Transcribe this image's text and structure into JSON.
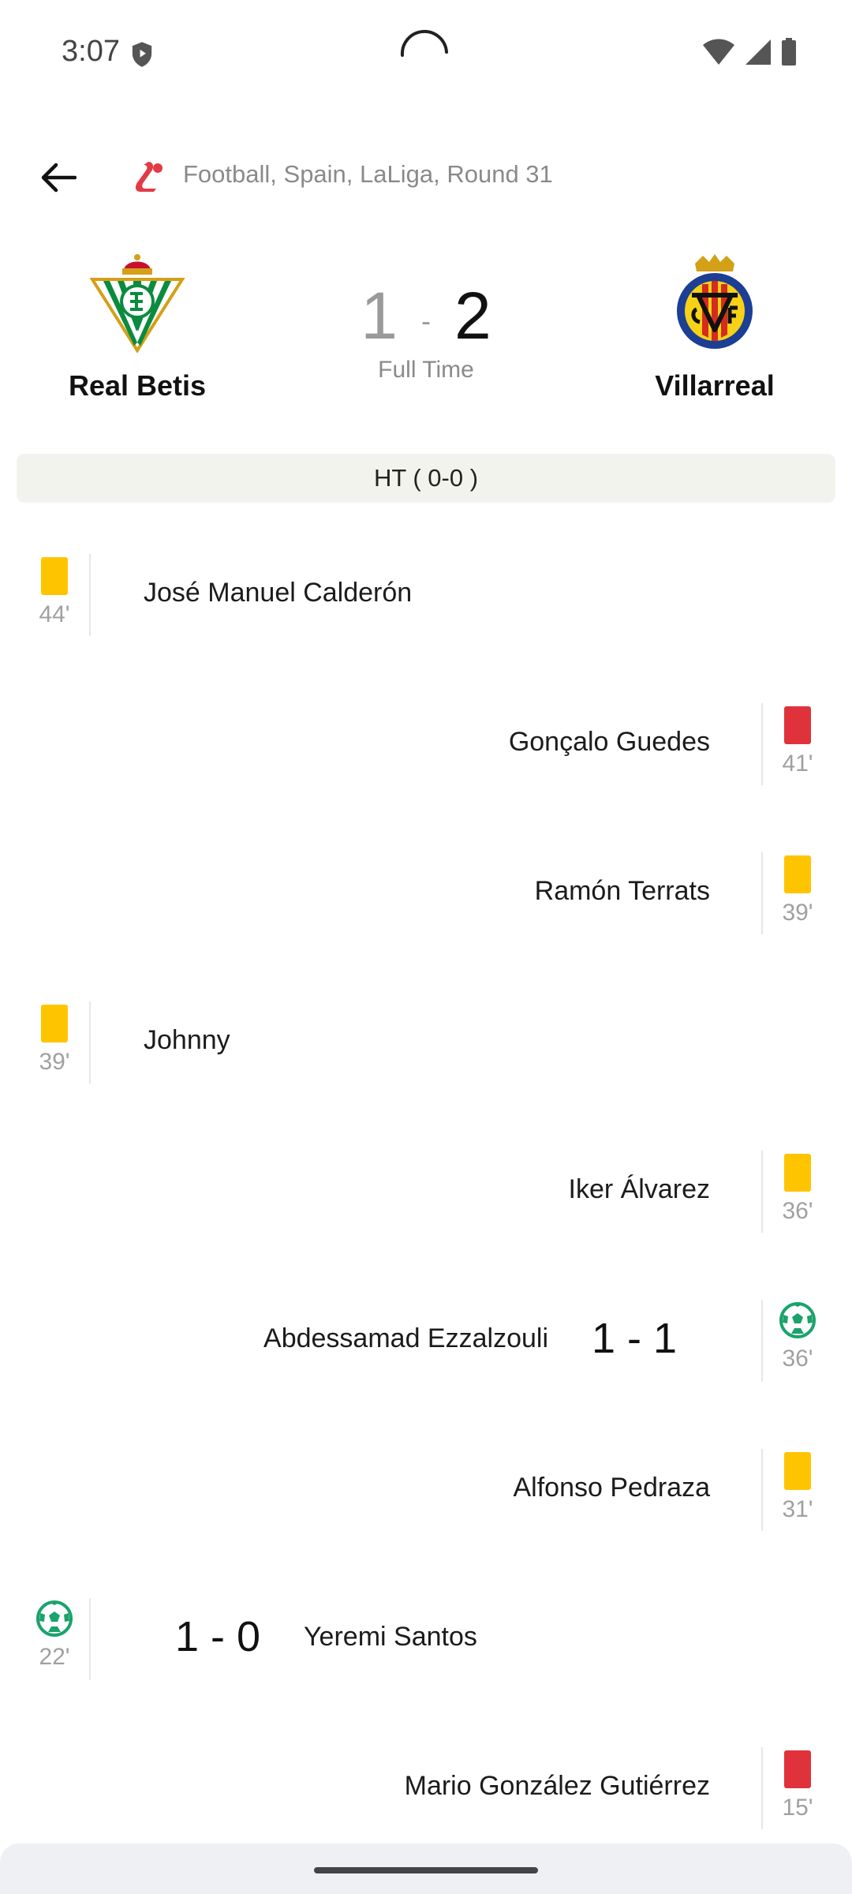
{
  "status_bar": {
    "time": "3:07"
  },
  "header": {
    "breadcrumb": "Football, Spain, LaLiga, Round 31",
    "league_color": "#e23b45"
  },
  "match": {
    "home": {
      "name": "Real Betis",
      "score": "1"
    },
    "away": {
      "name": "Villarreal",
      "score": "2"
    },
    "separator": "-",
    "status": "Full Time",
    "halftime": "HT ( 0-0 )"
  },
  "events": [
    {
      "side": "home",
      "type": "yellow-card",
      "minute": "44'",
      "player": "José Manuel Calderón"
    },
    {
      "side": "away",
      "type": "red-card",
      "minute": "41'",
      "player": "Gonçalo Guedes"
    },
    {
      "side": "away",
      "type": "yellow-card",
      "minute": "39'",
      "player": "Ramón Terrats"
    },
    {
      "side": "home",
      "type": "yellow-card",
      "minute": "39'",
      "player": "Johnny"
    },
    {
      "side": "away",
      "type": "yellow-card",
      "minute": "36'",
      "player": "Iker Álvarez"
    },
    {
      "side": "away",
      "type": "goal",
      "minute": "36'",
      "player": "Abdessamad Ezzalzouli",
      "score": "1 - 1"
    },
    {
      "side": "away",
      "type": "yellow-card",
      "minute": "31'",
      "player": "Alfonso Pedraza"
    },
    {
      "side": "home",
      "type": "goal",
      "minute": "22'",
      "player": "Yeremi Santos",
      "score": "1 - 0"
    },
    {
      "side": "away",
      "type": "red-card",
      "minute": "15'",
      "player": "Mario González Gutiérrez"
    }
  ],
  "colors": {
    "yellow_card": "#ffc400",
    "red_card": "#e0323a",
    "goal_icon": "#1aa36b"
  }
}
